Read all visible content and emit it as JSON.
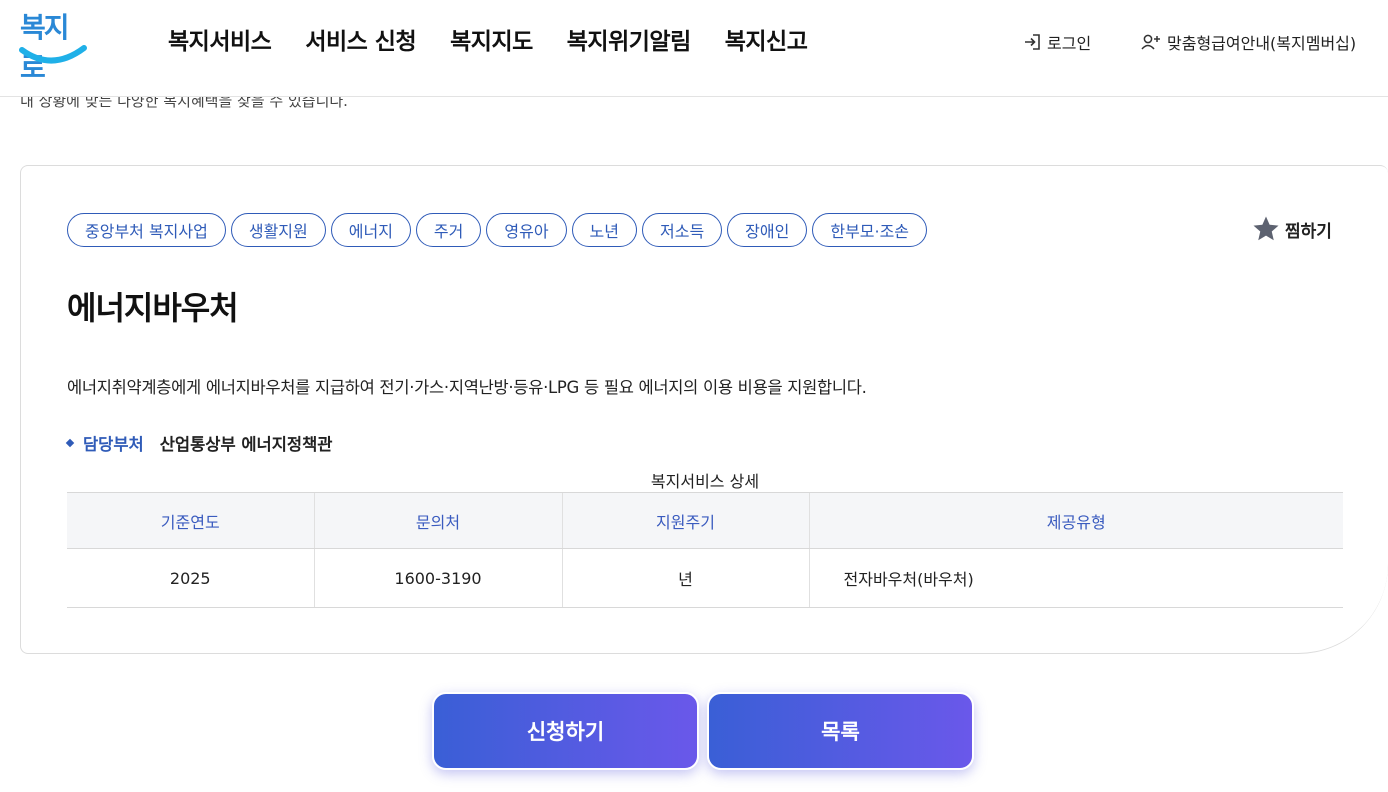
{
  "header": {
    "logo_text": "복지로",
    "nav": [
      "복지서비스",
      "서비스 신청",
      "복지지도",
      "복지위기알림",
      "복지신고"
    ],
    "login_label": "로그인",
    "member_label": "맞춤형급여안내(복지멤버십)"
  },
  "intro_text": "내 상황에 맞는 다양한 복지혜택을 찾을 수 있습니다.",
  "service": {
    "tags": [
      "중앙부처 복지사업",
      "생활지원",
      "에너지",
      "주거",
      "영유아",
      "노년",
      "저소득",
      "장애인",
      "한부모·조손"
    ],
    "favorite_label": "찜하기",
    "title": "에너지바우처",
    "description": "에너지취약계층에게 에너지바우처를 지급하여 전기·가스·지역난방·등유·LPG 등 필요 에너지의 이용 비용을 지원합니다.",
    "dept_label": "담당부처",
    "dept_value": "산업통상부 에너지정책관"
  },
  "detail_table": {
    "caption": "복지서비스 상세",
    "headers": [
      "기준연도",
      "문의처",
      "지원주기",
      "제공유형"
    ],
    "row": [
      "2025",
      "1600-3190",
      "년",
      "전자바우처(바우처)"
    ]
  },
  "buttons": {
    "apply_label": "신청하기",
    "list_label": "목록"
  },
  "colors": {
    "accent": "#2f5bb8",
    "button_gradient_start": "#3a5fd6",
    "button_gradient_end": "#6a58ea",
    "logo": "#2a88d6"
  }
}
